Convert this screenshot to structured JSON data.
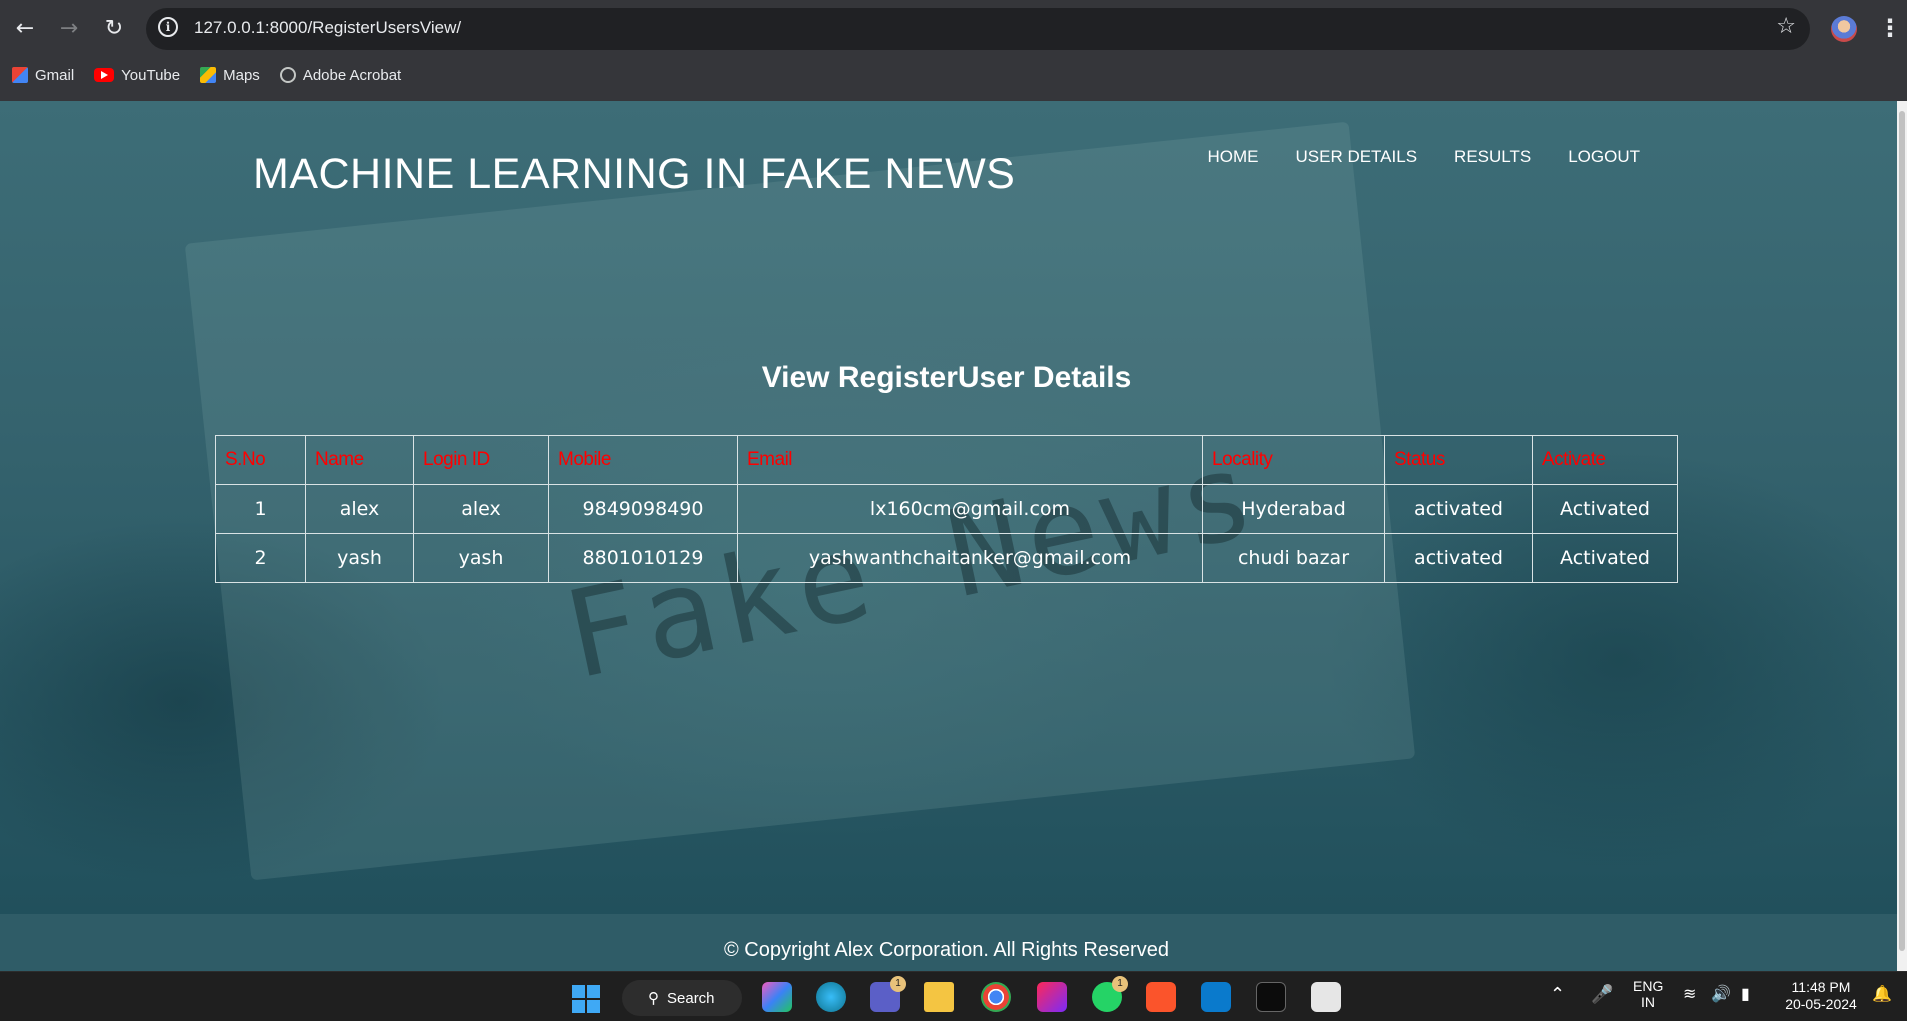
{
  "browser": {
    "url": "127.0.0.1:8000/RegisterUsersView/",
    "bookmarks": [
      "Gmail",
      "YouTube",
      "Maps",
      "Adobe Acrobat"
    ]
  },
  "site": {
    "title": "MACHINE LEARNING IN FAKE NEWS",
    "nav": [
      "HOME",
      "USER DETAILS",
      "RESULTS",
      "LOGOUT"
    ],
    "watermark": "Fake News"
  },
  "main": {
    "section_title": "View RegisterUser Details",
    "columns": [
      "S.No",
      "Name",
      "Login ID",
      "Mobile",
      "Email",
      "Locality",
      "Status",
      "Activate"
    ],
    "rows": [
      [
        "1",
        "alex",
        "alex",
        "9849098490",
        "lx160cm@gmail.com",
        "Hyderabad",
        "activated",
        "Activated"
      ],
      [
        "2",
        "yash",
        "yash",
        "8801010129",
        "yashwanthchaitanker@gmail.com",
        "chudi bazar",
        "activated",
        "Activated"
      ]
    ],
    "header_color": "#ff0000"
  },
  "footer": {
    "copyright": "© Copyright Alex Corporation. All Rights Reserved"
  },
  "taskbar": {
    "search_label": "Search",
    "teams_badge": "1",
    "whatsapp_badge": "1",
    "lang_top": "ENG",
    "lang_bottom": "IN",
    "time": "11:48 PM",
    "date": "20-05-2024"
  }
}
